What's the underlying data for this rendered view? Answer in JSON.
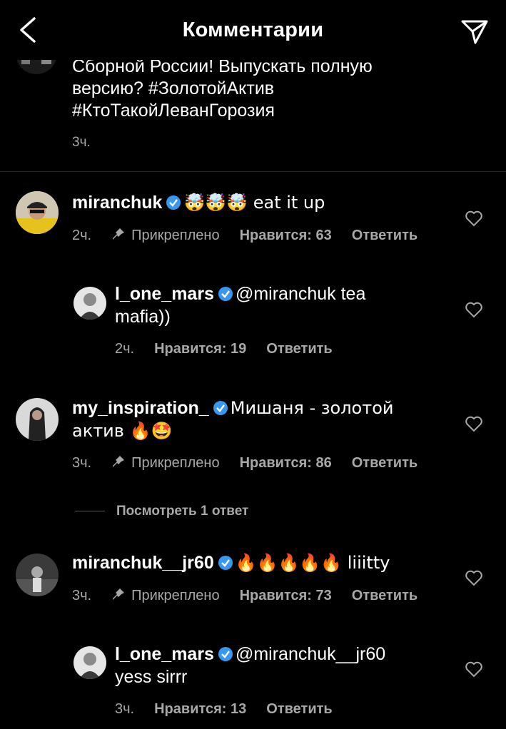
{
  "header": {
    "title": "Комментарии"
  },
  "caption": {
    "lines": [
      "Сборной России! Выпускать полную",
      "версию? #ЗолотойАктив",
      "#КтоТакойЛеванГорозия"
    ],
    "time": "3ч."
  },
  "comments": [
    {
      "username": "miranchuk",
      "verified": true,
      "text": "🤯🤯🤯 eat it up",
      "time": "2ч.",
      "pinned": "Прикреплено",
      "likes": "Нравится: 63",
      "reply": "Ответить"
    },
    {
      "username": "l_one_mars",
      "verified": true,
      "text": "@miranchuk tea mafia))",
      "time": "2ч.",
      "likes": "Нравится: 19",
      "reply": "Ответить"
    },
    {
      "username": "my_inspiration_",
      "verified": true,
      "text": "Мишаня - золотой актив 🔥🤩",
      "time": "3ч.",
      "pinned": "Прикреплено",
      "likes": "Нравится: 86",
      "reply": "Ответить",
      "view_replies": "Посмотреть 1 ответ"
    },
    {
      "username": "miranchuk__jr60",
      "verified": true,
      "text": "🔥🔥🔥🔥🔥 liiitty",
      "time": "3ч.",
      "pinned": "Прикреплено",
      "likes": "Нравится: 73",
      "reply": "Ответить"
    },
    {
      "username": "l_one_mars",
      "verified": true,
      "text": "@miranchuk__jr60 yess sirrr",
      "time": "3ч.",
      "likes": "Нравится: 13",
      "reply": "Ответить"
    }
  ],
  "icons": {
    "back": "chevron-left-icon",
    "send": "paper-plane-icon",
    "heart": "heart-outline-icon",
    "pin": "pin-icon",
    "verified": "verified-badge-icon"
  },
  "colors": {
    "background": "#000000",
    "text": "#ffffff",
    "secondary": "#a8a8a8",
    "verified": "#3897f0"
  }
}
